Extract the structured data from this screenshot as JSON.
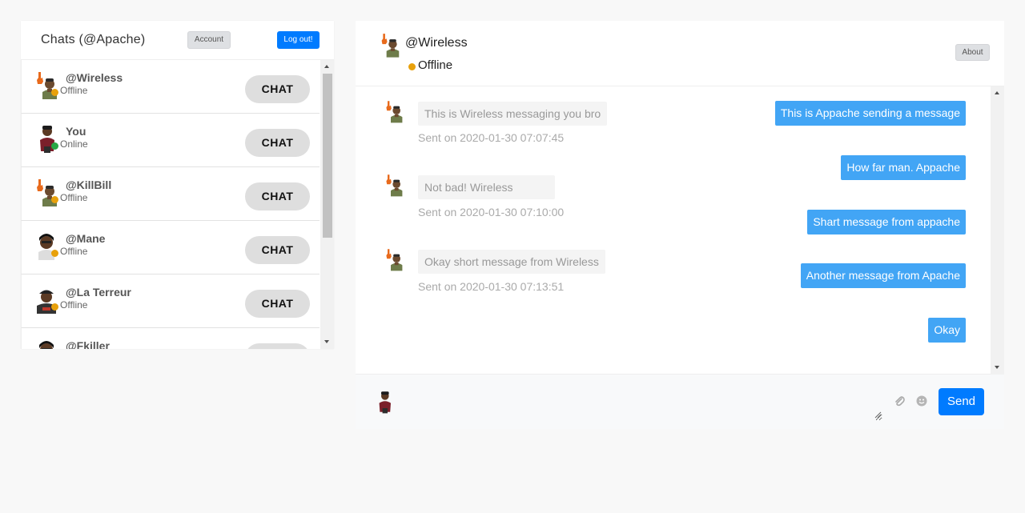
{
  "sidebar": {
    "title": "Chats (@Apache)",
    "account_label": "Account",
    "logout_label": "Log out!",
    "chat_label": "CHAT",
    "users": [
      {
        "name": "@Wireless",
        "status": "Offline",
        "online": false
      },
      {
        "name": "You",
        "status": "Online",
        "online": true
      },
      {
        "name": "@KillBill",
        "status": "Offline",
        "online": false
      },
      {
        "name": "@Mane",
        "status": "Offline",
        "online": false
      },
      {
        "name": "@La Terreur",
        "status": "Offline",
        "online": false
      },
      {
        "name": "@Fkiller",
        "status": "",
        "online": false
      }
    ]
  },
  "conversation": {
    "contact_name": "@Wireless",
    "contact_status": "Offline",
    "about_label": "About",
    "incoming": [
      {
        "text": "This is Wireless messaging you bro",
        "time": "Sent on 2020-01-30 07:07:45"
      },
      {
        "text": "Not bad! Wireless",
        "time": "Sent on 2020-01-30 07:10:00"
      },
      {
        "text": "Okay short message from Wireless",
        "time": "Sent on 2020-01-30 07:13:51"
      }
    ],
    "outgoing": [
      {
        "text": "This is Appache sending a message"
      },
      {
        "text": "How far man. Appache"
      },
      {
        "text": "Shart message from appache"
      },
      {
        "text": "Another message from Apache"
      },
      {
        "text": "Okay"
      }
    ]
  },
  "composer": {
    "send_label": "Send",
    "placeholder": ""
  },
  "colors": {
    "primary": "#007bff",
    "outgoing_bubble": "#42a5f5",
    "offline": "#e8a10c",
    "online": "#28a745"
  },
  "icons": [
    "avatar-hand-icon",
    "avatar-person-icon",
    "paperclip-icon",
    "smiley-icon"
  ]
}
